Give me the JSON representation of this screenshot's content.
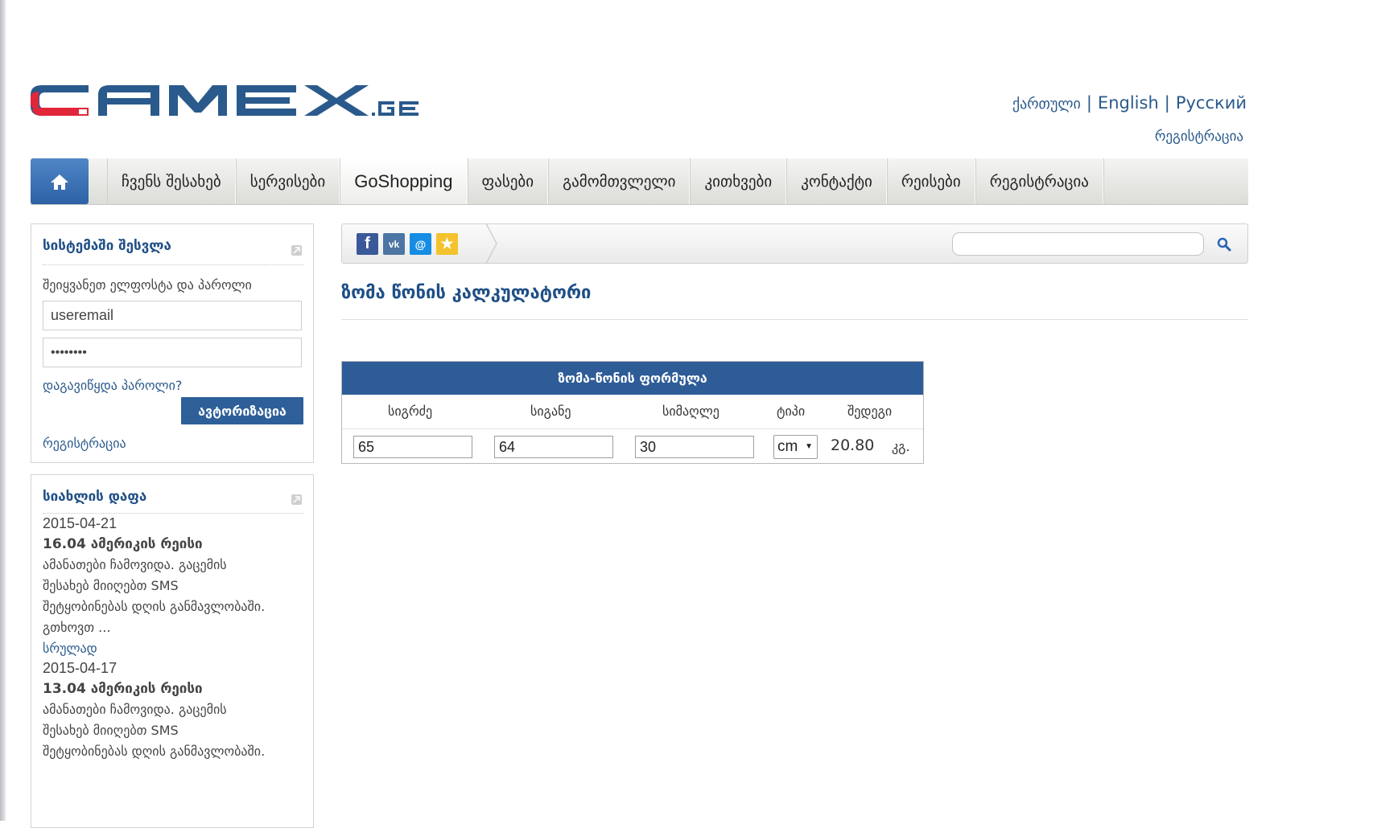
{
  "header": {
    "logo_text": "CAMEX.GE",
    "languages": [
      "ქართული",
      "English",
      "Русский"
    ],
    "register_link": "რეგისტრაცია"
  },
  "nav": {
    "home_icon": "home-icon",
    "items": [
      "ჩვენს შესახებ",
      "სერვისები",
      "GoShopping",
      "ფასები",
      "გამომთვლელი",
      "კითხვები",
      "კონტაქტი",
      "რეისები",
      "რეგისტრაცია"
    ]
  },
  "login": {
    "title": "სისტემაში შესვლა",
    "hint": "შეიყვანეთ ელფოსტა და პაროლი",
    "email_value": "useremail",
    "password_value": "••••••••",
    "forgot": "დაგავიწყდა პაროლი?",
    "submit": "ავტორიზაცია",
    "register": "რეგისტრაცია"
  },
  "news": {
    "title": "სიახლის დაფა",
    "items": [
      {
        "date": "2015-04-21",
        "headline": "16.04 ამერიკის რეისი",
        "lines": [
          "ამანათები ჩამოვიდა. გაცემის",
          "შესახებ მიიღებთ SMS",
          "შეტყობინებას დღის განმავლობაში.",
          "გთხოვთ ..."
        ],
        "more": "სრულად"
      },
      {
        "date": "2015-04-17",
        "headline": "13.04 ამერიკის რეისი",
        "lines": [
          "ამანათები ჩამოვიდა. გაცემის",
          "შესახებ მიიღებთ SMS",
          "შეტყობინებას დღის განმავლობაში."
        ],
        "more": ""
      }
    ]
  },
  "social": [
    "facebook-icon",
    "vk-icon",
    "mail-icon",
    "favorite-star-icon"
  ],
  "search": {
    "placeholder": ""
  },
  "page": {
    "title": "ზომა წონის კალკულატორი"
  },
  "calculator": {
    "header": "ზომა-წონის ფორმულა",
    "columns": [
      "სიგრძე",
      "სიგანე",
      "სიმაღლე",
      "ტიპი",
      "შედეგი"
    ],
    "length": "65",
    "width": "64",
    "height": "30",
    "unit": "cm",
    "result": "20.80",
    "result_unit": "კგ."
  },
  "colors": {
    "brand_blue": "#2e5c97",
    "link_blue": "#2a5a8c",
    "logo_red": "#e2263a"
  }
}
